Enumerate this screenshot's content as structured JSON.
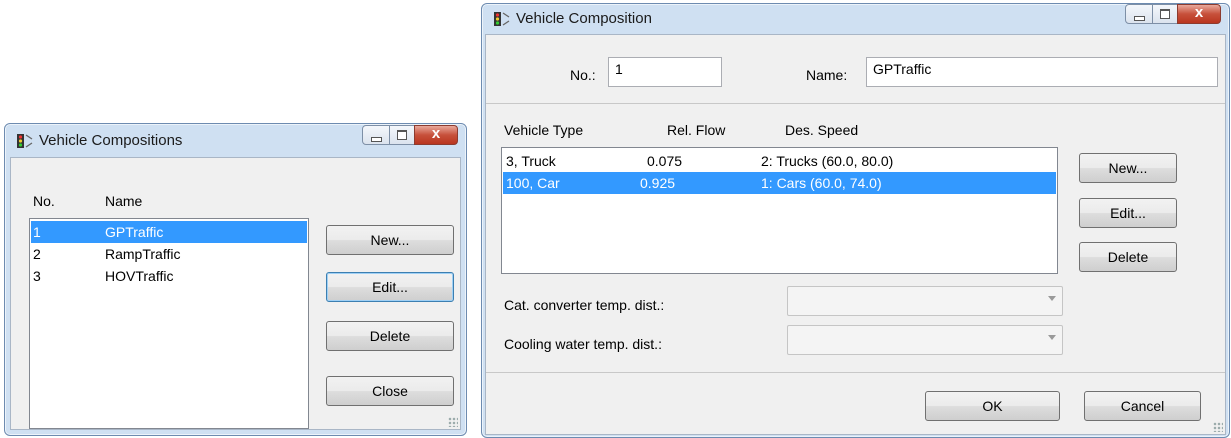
{
  "left_window": {
    "title": "Vehicle Compositions",
    "icon": "traffic-signal-icon",
    "columns": [
      "No.",
      "Name"
    ],
    "rows": [
      {
        "no": "1",
        "name": "GPTraffic",
        "selected": true
      },
      {
        "no": "2",
        "name": "RampTraffic",
        "selected": false
      },
      {
        "no": "3",
        "name": "HOVTraffic",
        "selected": false
      }
    ],
    "buttons": {
      "new": "New...",
      "edit": "Edit...",
      "delete": "Delete",
      "close": "Close"
    }
  },
  "right_window": {
    "title": "Vehicle Composition",
    "icon": "traffic-signal-icon",
    "no_label": "No.:",
    "no_value": "1",
    "name_label": "Name:",
    "name_value": "GPTraffic",
    "columns": [
      "Vehicle Type",
      "Rel. Flow",
      "Des. Speed"
    ],
    "rows": [
      {
        "type": "3, Truck",
        "flow": "0.075",
        "speed": "2: Trucks (60.0, 80.0)",
        "selected": false
      },
      {
        "type": "100, Car",
        "flow": "0.925",
        "speed": "1: Cars (60.0, 74.0)",
        "selected": true
      }
    ],
    "buttons": {
      "new": "New...",
      "edit": "Edit...",
      "delete": "Delete",
      "ok": "OK",
      "cancel": "Cancel"
    },
    "cat_converter_label": "Cat. converter temp. dist.:",
    "cat_converter_value": "",
    "cooling_water_label": "Cooling water temp. dist.:",
    "cooling_water_value": ""
  },
  "colors": {
    "selection": "#3399ff",
    "frame": "#cfe0f2",
    "client": "#f0f0f0"
  }
}
